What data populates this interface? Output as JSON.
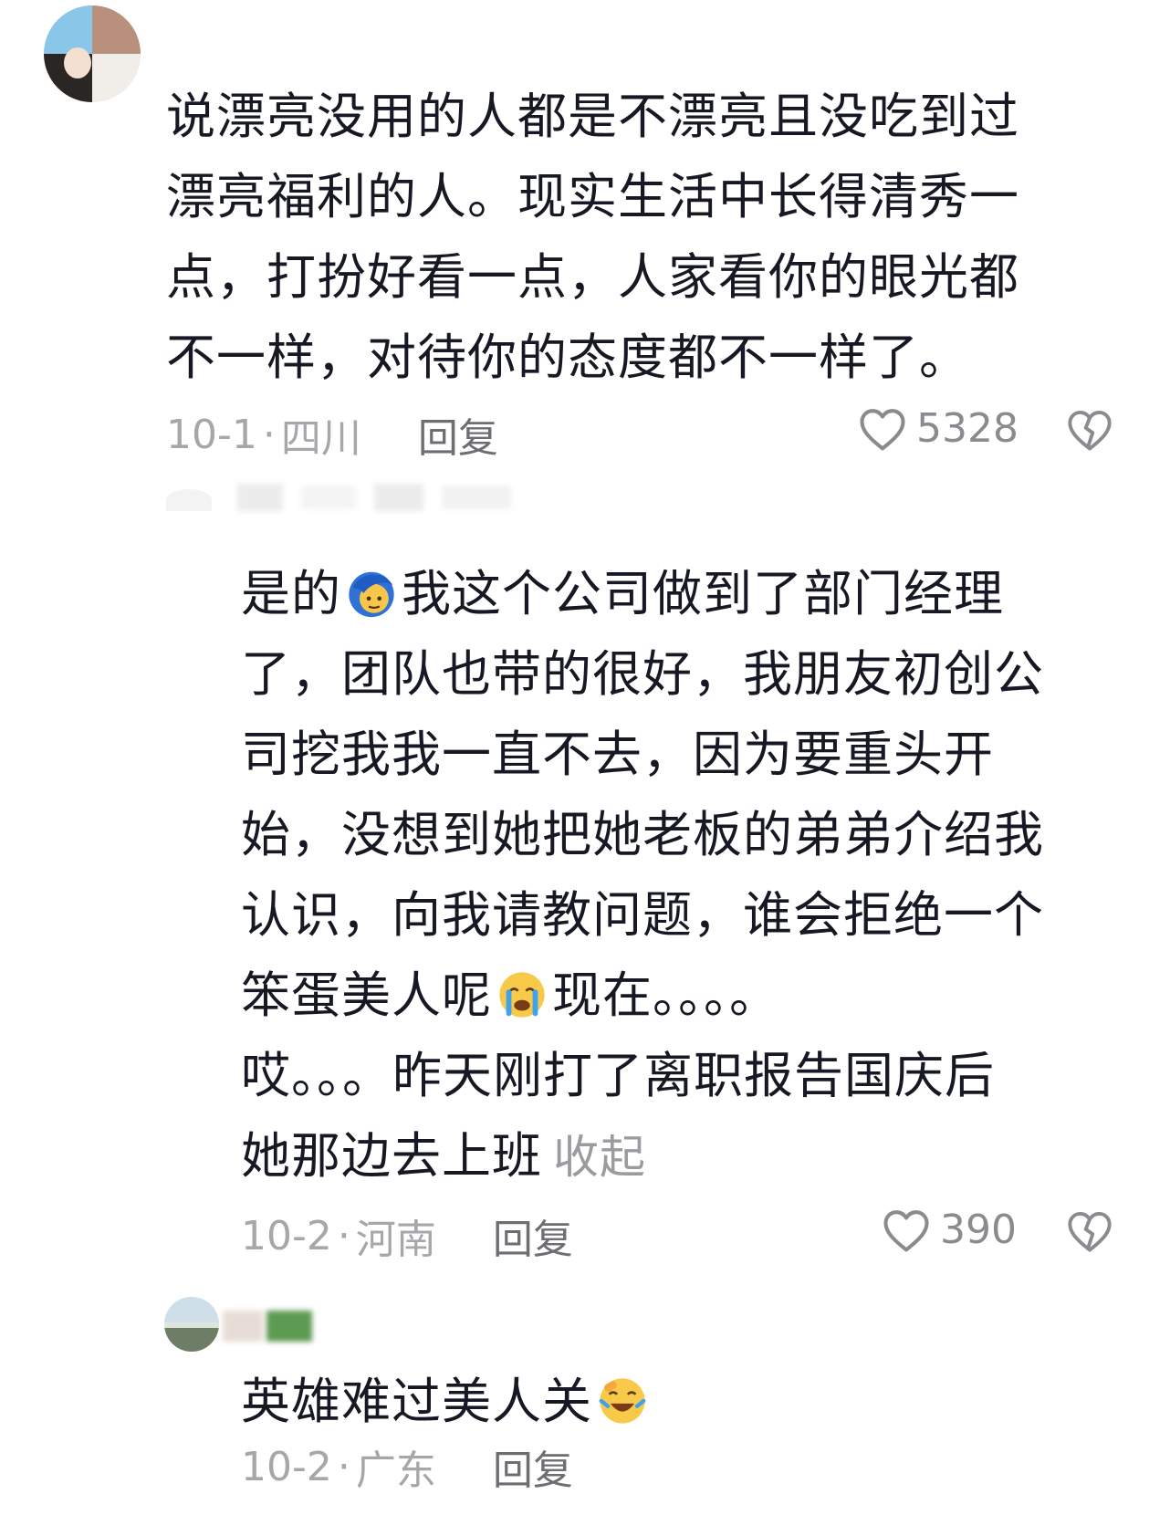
{
  "comments": [
    {
      "lines": [
        "说漂亮没用的人都是不漂亮且没吃到过",
        "漂亮福利的人。现实生活中长得清秀一",
        "点，打扮好看一点，人家看你的眼光都",
        "不一样，对待你的态度都不一样了。"
      ],
      "date": "10-1",
      "dot": "·",
      "location": "四川",
      "reply_label": "回复",
      "likes": "5328"
    },
    {
      "line1_a": "是的",
      "line1_b": "我这个公司做到了部门经理",
      "lines_mid": [
        "了，团队也带的很好，我朋友初创公",
        "司挖我我一直不去，因为要重头开",
        "始，没想到她把她老板的弟弟介绍我",
        "认识，向我请教问题，谁会拒绝一个"
      ],
      "line6_a": "笨蛋美人呢",
      "line6_b": "现在。。。。",
      "line7": "哎。。。昨天刚打了离职报告国庆后",
      "line8": "她那边去上班",
      "collapse_label": "收起",
      "date": "10-2",
      "dot": "·",
      "location": "河南",
      "reply_label": "回复",
      "likes": "390"
    },
    {
      "text": "英雄难过美人关",
      "date": "10-2",
      "dot": "·",
      "location": "广东",
      "reply_label": "回复"
    }
  ],
  "icons": {
    "heart": "heart-outline-icon",
    "dislike": "broken-heart-icon",
    "emoji1": "blue-hair-face-emoji",
    "emoji2": "crying-face-emoji",
    "emoji3": "laughing-face-emoji"
  },
  "colors": {
    "text": "#161823",
    "meta": "#a7a7ab",
    "reply": "#6d6d72"
  }
}
